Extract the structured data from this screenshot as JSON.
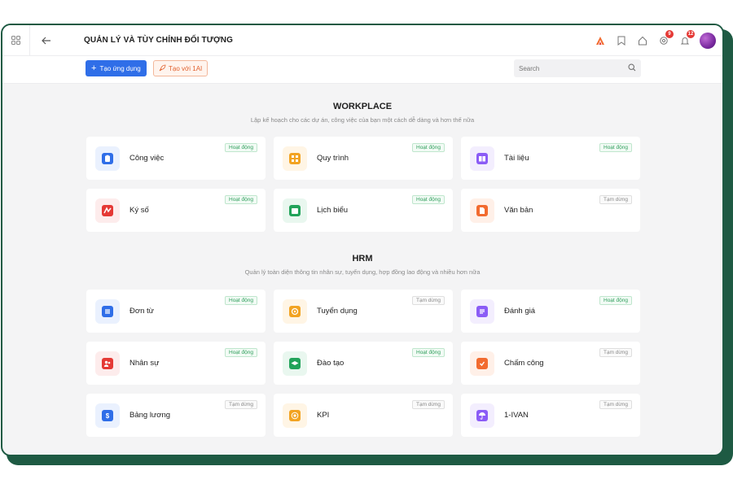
{
  "header": {
    "title": "QUẢN LÝ VÀ TÙY CHỈNH ĐỐI TƯỢNG",
    "notifications": [
      {
        "icon": "triangle-logo-icon",
        "count": null
      },
      {
        "icon": "bookmark-icon",
        "count": null
      },
      {
        "icon": "home-icon",
        "count": null
      },
      {
        "icon": "settings-icon",
        "count": "9"
      },
      {
        "icon": "bell-icon",
        "count": "12"
      }
    ]
  },
  "toolbar": {
    "create_label": "Tạo ứng dụng",
    "ai_label": "Tạo với 1AI",
    "search_placeholder": "Search"
  },
  "colors": {
    "primary": "#2f6ee8",
    "ai_accent": "#e2622f",
    "frame": "#1e5a43",
    "active_status": "#2e9e5b"
  },
  "sections": [
    {
      "title": "WORKPLACE",
      "subtitle": "Lập kế hoạch cho các dự án, công việc của bạn một cách dễ dàng và hơn thế nữa",
      "apps": [
        {
          "name": "Công việc",
          "status": "Hoạt động",
          "active": true,
          "icon": "clipboard-icon",
          "color": "#2f6ee8",
          "bg": "#eaf1fe"
        },
        {
          "name": "Quy trình",
          "status": "Hoạt động",
          "active": true,
          "icon": "workflow-icon",
          "color": "#f2a321",
          "bg": "#fff5e5"
        },
        {
          "name": "Tài liệu",
          "status": "Hoạt động",
          "active": true,
          "icon": "book-icon",
          "color": "#8b5cf6",
          "bg": "#f3eefe"
        },
        {
          "name": "Ký số",
          "status": "Hoạt động",
          "active": true,
          "icon": "signature-icon",
          "color": "#e53935",
          "bg": "#fdecec"
        },
        {
          "name": "Lịch biểu",
          "status": "Hoạt động",
          "active": true,
          "icon": "calendar-icon",
          "color": "#22a35a",
          "bg": "#e9f7ef"
        },
        {
          "name": "Văn bản",
          "status": "Tạm dừng",
          "active": false,
          "icon": "document-icon",
          "color": "#f26b2f",
          "bg": "#fff0e8"
        }
      ]
    },
    {
      "title": "HRM",
      "subtitle": "Quản lý toàn diện thông tin nhân sự, tuyển dụng, hợp đồng lao động và nhiều hơn nữa",
      "apps": [
        {
          "name": "Đơn từ",
          "status": "Hoạt động",
          "active": true,
          "icon": "form-icon",
          "color": "#2f6ee8",
          "bg": "#eaf1fe"
        },
        {
          "name": "Tuyển dụng",
          "status": "Tạm dừng",
          "active": false,
          "icon": "recruit-icon",
          "color": "#f2a321",
          "bg": "#fff5e5"
        },
        {
          "name": "Đánh giá",
          "status": "Hoạt động",
          "active": true,
          "icon": "evaluation-icon",
          "color": "#8b5cf6",
          "bg": "#f3eefe"
        },
        {
          "name": "Nhân sự",
          "status": "Hoạt động",
          "active": true,
          "icon": "people-icon",
          "color": "#e53935",
          "bg": "#fdecec"
        },
        {
          "name": "Đào tạo",
          "status": "Hoạt động",
          "active": true,
          "icon": "graduation-cap-icon",
          "color": "#22a35a",
          "bg": "#e9f7ef"
        },
        {
          "name": "Chấm công",
          "status": "Tạm dừng",
          "active": false,
          "icon": "check-clock-icon",
          "color": "#f26b2f",
          "bg": "#fff0e8"
        },
        {
          "name": "Bảng lương",
          "status": "Tạm dừng",
          "active": false,
          "icon": "dollar-icon",
          "color": "#2f6ee8",
          "bg": "#eaf1fe"
        },
        {
          "name": "KPI",
          "status": "Tạm dừng",
          "active": false,
          "icon": "target-icon",
          "color": "#f2a321",
          "bg": "#fff5e5"
        },
        {
          "name": "1-IVAN",
          "status": "Tạm dừng",
          "active": false,
          "icon": "umbrella-icon",
          "color": "#8b5cf6",
          "bg": "#f3eefe"
        }
      ]
    }
  ]
}
